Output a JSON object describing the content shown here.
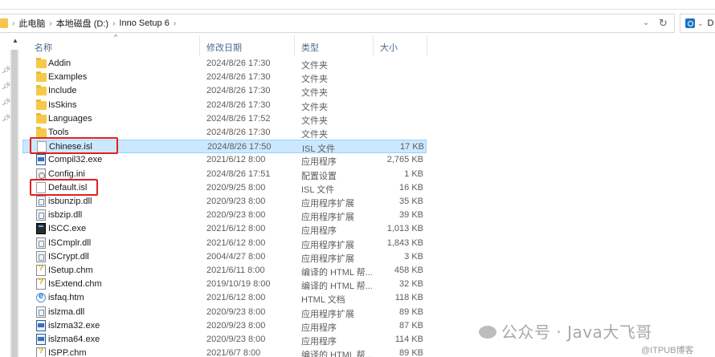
{
  "breadcrumb": {
    "items": [
      "此电脑",
      "本地磁盘 (D:)",
      "Inno Setup 6"
    ]
  },
  "search": {
    "scope_label": "D"
  },
  "columns": {
    "name": "名称",
    "date": "修改日期",
    "type": "类型",
    "size": "大小"
  },
  "files": [
    {
      "name": "Addin",
      "date": "2024/8/26 17:30",
      "type": "文件夹",
      "size": "",
      "icon": "folder-icon"
    },
    {
      "name": "Examples",
      "date": "2024/8/26 17:30",
      "type": "文件夹",
      "size": "",
      "icon": "folder-icon"
    },
    {
      "name": "Include",
      "date": "2024/8/26 17:30",
      "type": "文件夹",
      "size": "",
      "icon": "folder-icon"
    },
    {
      "name": "IsSkins",
      "date": "2024/8/26 17:30",
      "type": "文件夹",
      "size": "",
      "icon": "folder-icon"
    },
    {
      "name": "Languages",
      "date": "2024/8/26 17:52",
      "type": "文件夹",
      "size": "",
      "icon": "folder-icon"
    },
    {
      "name": "Tools",
      "date": "2024/8/26 17:30",
      "type": "文件夹",
      "size": "",
      "icon": "folder-icon"
    },
    {
      "name": "Chinese.isl",
      "date": "2024/8/26 17:50",
      "type": "ISL 文件",
      "size": "17 KB",
      "icon": "file-icon",
      "selected": true,
      "highlighted": true
    },
    {
      "name": "Compil32.exe",
      "date": "2021/6/12 8:00",
      "type": "应用程序",
      "size": "2,765 KB",
      "icon": "exe-icon"
    },
    {
      "name": "Config.ini",
      "date": "2024/8/26 17:51",
      "type": "配置设置",
      "size": "1 KB",
      "icon": "ini-icon"
    },
    {
      "name": "Default.isl",
      "date": "2020/9/25 8:00",
      "type": "ISL 文件",
      "size": "16 KB",
      "icon": "file-icon",
      "highlighted": true
    },
    {
      "name": "isbunzip.dll",
      "date": "2020/9/23 8:00",
      "type": "应用程序扩展",
      "size": "35 KB",
      "icon": "dll-icon"
    },
    {
      "name": "isbzip.dll",
      "date": "2020/9/23 8:00",
      "type": "应用程序扩展",
      "size": "39 KB",
      "icon": "dll-icon"
    },
    {
      "name": "ISCC.exe",
      "date": "2021/6/12 8:00",
      "type": "应用程序",
      "size": "1,013 KB",
      "icon": "console-icon"
    },
    {
      "name": "ISCmplr.dll",
      "date": "2021/6/12 8:00",
      "type": "应用程序扩展",
      "size": "1,843 KB",
      "icon": "dll-icon"
    },
    {
      "name": "ISCrypt.dll",
      "date": "2004/4/27 8:00",
      "type": "应用程序扩展",
      "size": "3 KB",
      "icon": "dll-icon"
    },
    {
      "name": "ISetup.chm",
      "date": "2021/6/11 8:00",
      "type": "编译的 HTML 帮...",
      "size": "458 KB",
      "icon": "help-icon"
    },
    {
      "name": "IsExtend.chm",
      "date": "2019/10/19 8:00",
      "type": "编译的 HTML 帮...",
      "size": "32 KB",
      "icon": "help-icon"
    },
    {
      "name": "isfaq.htm",
      "date": "2021/6/12 8:00",
      "type": "HTML 文档",
      "size": "118 KB",
      "icon": "browser-icon"
    },
    {
      "name": "islzma.dll",
      "date": "2020/9/23 8:00",
      "type": "应用程序扩展",
      "size": "89 KB",
      "icon": "dll-icon"
    },
    {
      "name": "islzma32.exe",
      "date": "2020/9/23 8:00",
      "type": "应用程序",
      "size": "87 KB",
      "icon": "exe-icon"
    },
    {
      "name": "islzma64.exe",
      "date": "2020/9/23 8:00",
      "type": "应用程序",
      "size": "114 KB",
      "icon": "exe-icon"
    },
    {
      "name": "ISPP.chm",
      "date": "2021/6/7 8:00",
      "type": "编译的 HTML 帮...",
      "size": "89 KB",
      "icon": "help-icon"
    }
  ],
  "watermark": {
    "main": "公众号 · Java大飞哥",
    "sub": "@ITPUB博客"
  },
  "colors": {
    "selection_bg": "#cce8ff",
    "highlight_border": "#e0201f",
    "header_text": "#4d6a8c"
  }
}
